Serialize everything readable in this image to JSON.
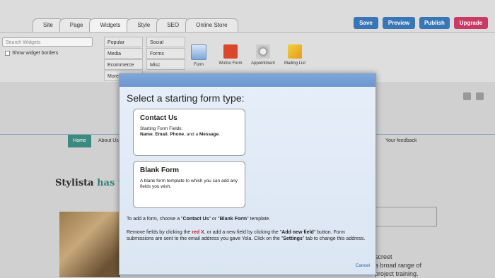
{
  "editor": {
    "tabs": [
      "Site",
      "Page",
      "Widgets",
      "Style",
      "SEO",
      "Online Store"
    ],
    "actions": [
      {
        "label": "Save",
        "color": "#3876b6"
      },
      {
        "label": "Preview",
        "color": "#3876b6"
      },
      {
        "label": "Publish",
        "color": "#3876b6"
      },
      {
        "label": "Upgrade",
        "color": "#c93a66"
      }
    ],
    "search_placeholder": "Search Widgets",
    "show_borders_label": "Show widget borders",
    "categories": [
      "Popular",
      "Social",
      "Media",
      "Forms",
      "Ecommerce",
      "Misc",
      "More"
    ],
    "widgets": [
      {
        "label": "Form",
        "icon": "form-icon"
      },
      {
        "label": "Wufoo Form",
        "icon": "wufoo-icon"
      },
      {
        "label": "Appointment",
        "icon": "appointment-icon"
      },
      {
        "label": "Mailing List",
        "icon": "mailing-list-icon"
      }
    ]
  },
  "site": {
    "nav_home": "Home",
    "nav_about": "About Us",
    "nav_feedback": "Your feedback",
    "brand_name": "Stylista",
    "brand_suffix": "has the",
    "right_line1": "screet",
    "right_line2": "a broad range of",
    "right_line3": "project training."
  },
  "modal": {
    "title": "Select a starting form type:",
    "contact": {
      "title": "Contact Us",
      "line1": "Starting Form Fields:",
      "f_name": "Name",
      "f_email": "Email",
      "f_phone": "Phone",
      "and_a": ", and a ",
      "f_message": "Message",
      "period": "."
    },
    "blank": {
      "title": "Blank Form",
      "desc": "A blank form template to which you can add any fields you wish."
    },
    "note1_a": "To add a form, choose a \"",
    "note1_contact": "Contact Us",
    "note1_b": "\" or \"",
    "note1_blank": "Blank Form",
    "note1_c": "\" template.",
    "note2_a": "Remove fields by clicking the ",
    "note2_redx": "red X",
    "note2_b": ", or add a new field by clicking the \"",
    "note2_add": "Add new field",
    "note2_c": "\" button. Form submissions are sent to the email address you gave Yola. Click on the \"",
    "note2_settings": "Settings",
    "note2_d": "\" tab to change this address.",
    "cancel": "Cancel"
  }
}
